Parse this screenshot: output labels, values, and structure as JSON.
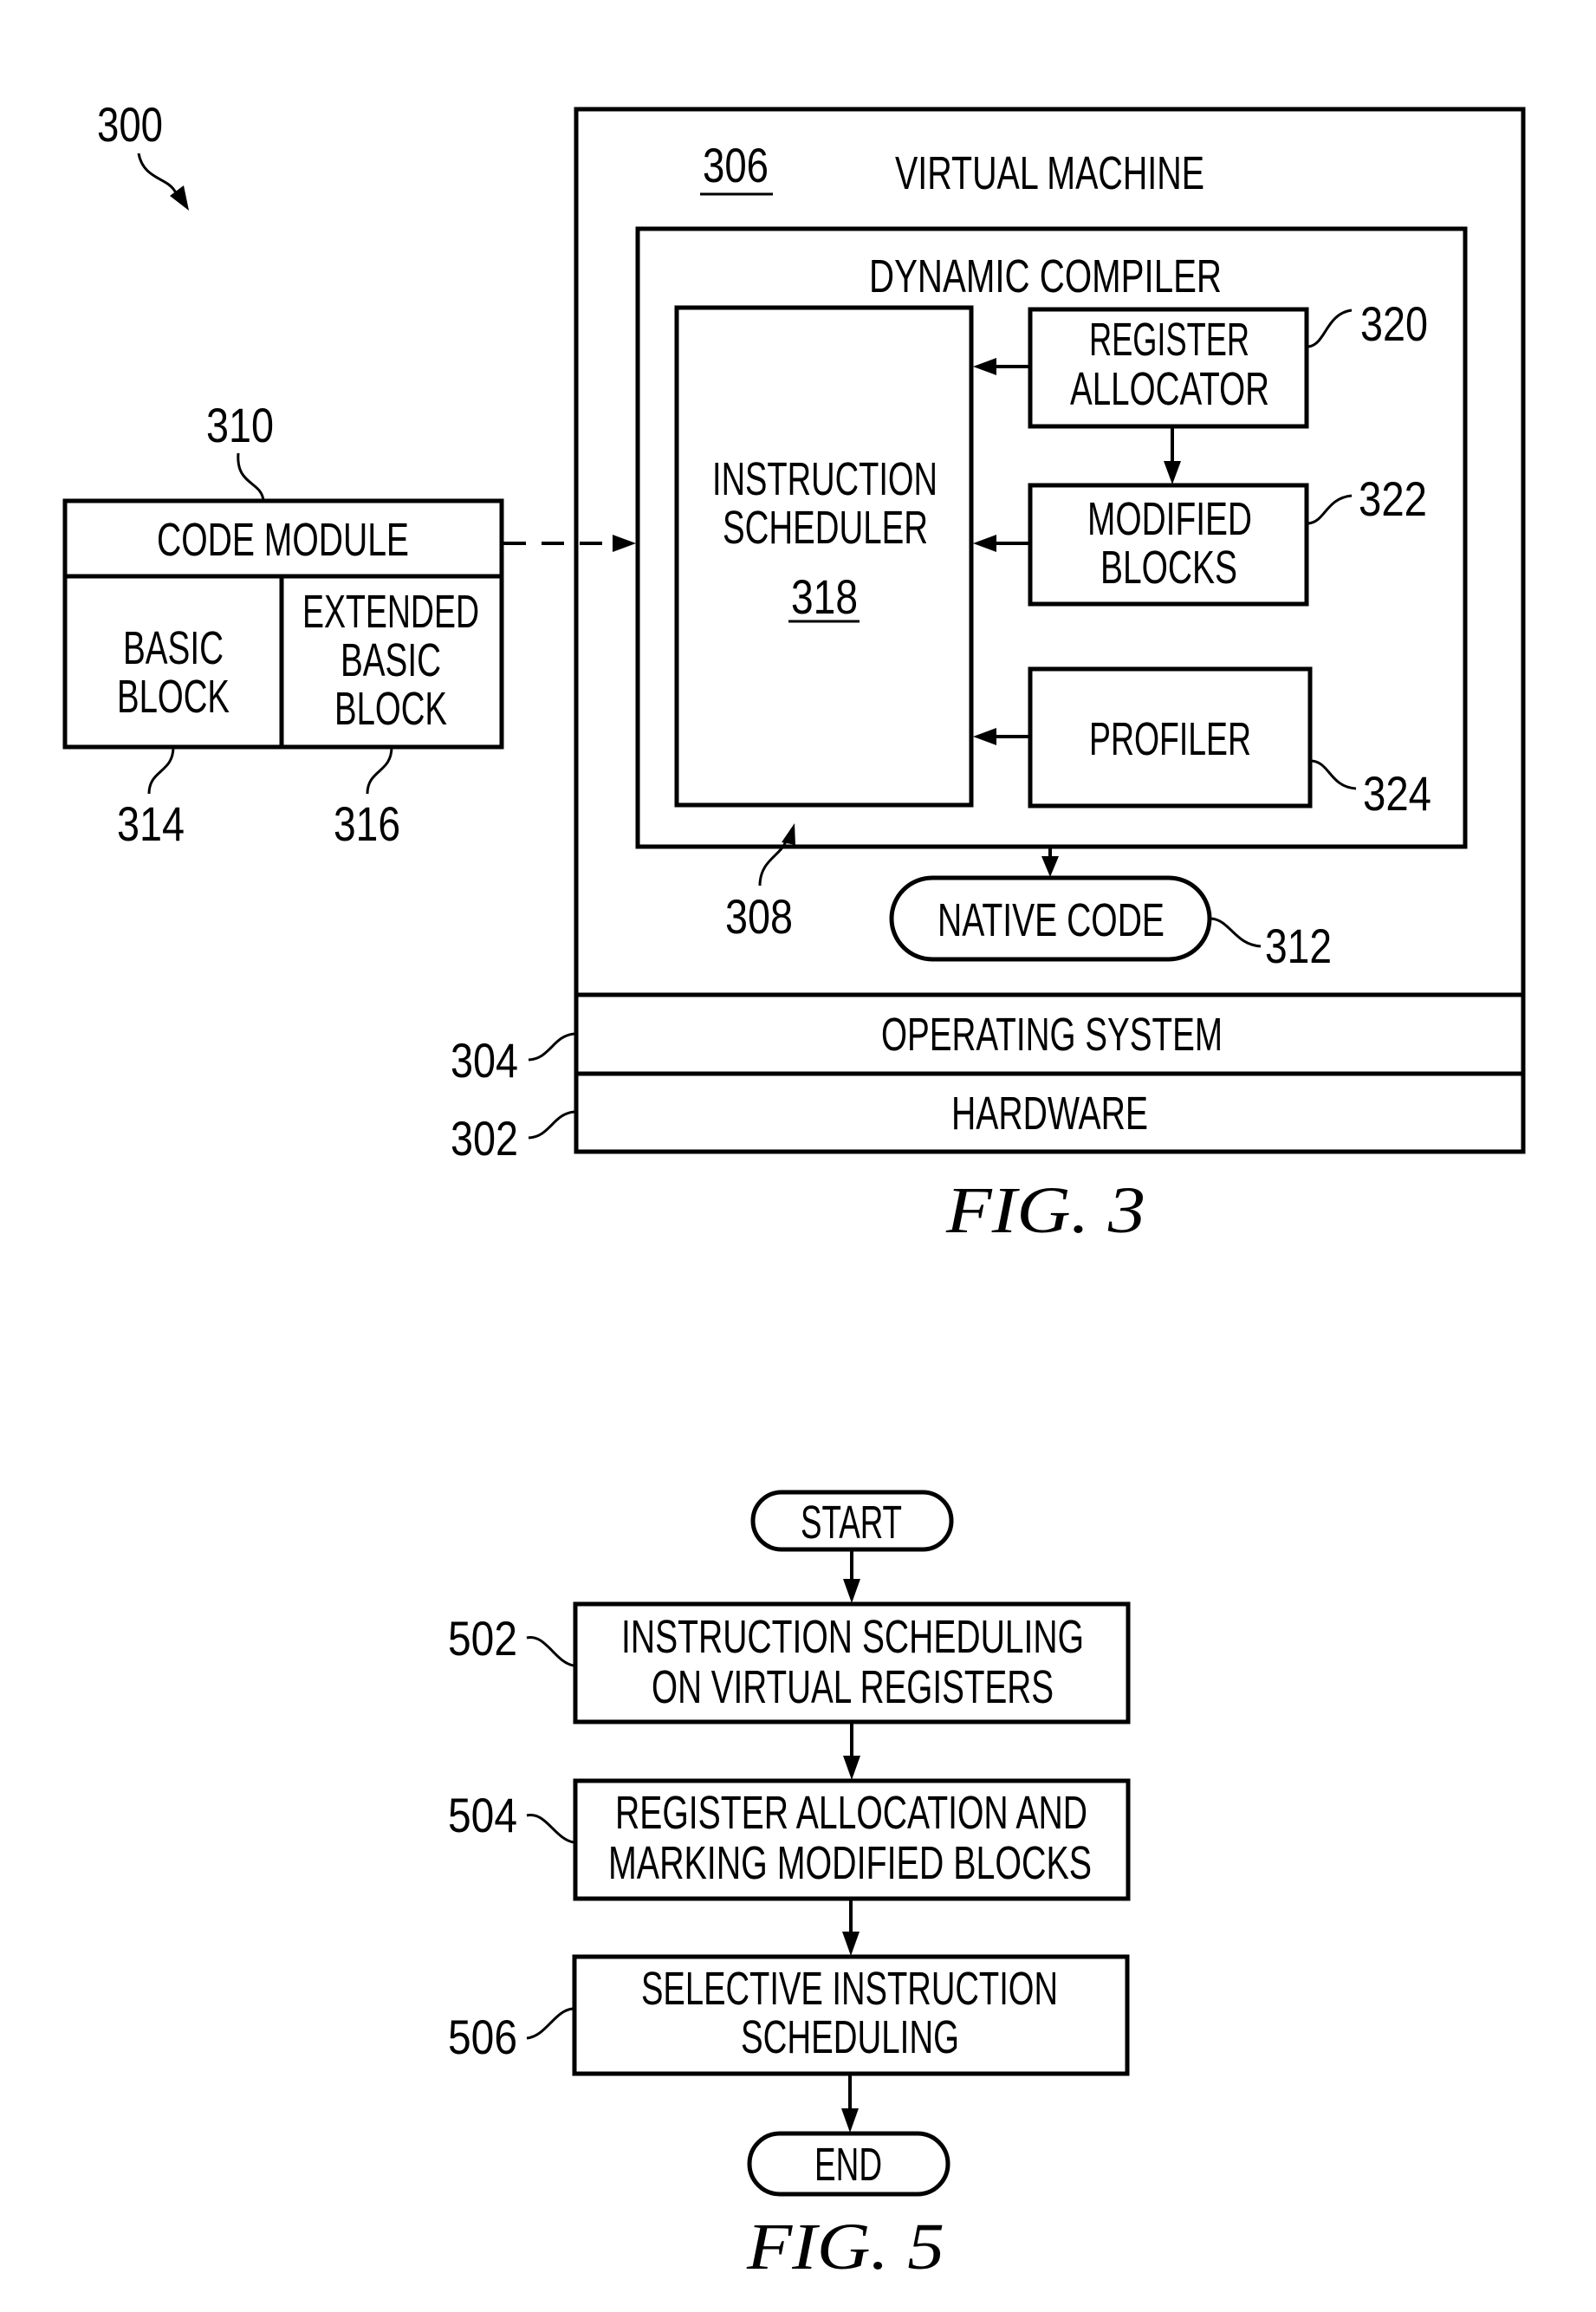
{
  "figures": {
    "fig3": {
      "caption": "FIG. 3",
      "ref_system": "300",
      "virtual_machine": {
        "ref": "306",
        "label": "VIRTUAL MACHINE"
      },
      "dynamic_compiler": {
        "ref": "308",
        "label": "DYNAMIC COMPILER"
      },
      "instruction_scheduler": {
        "ref": "318",
        "lines": [
          "INSTRUCTION",
          "SCHEDULER"
        ]
      },
      "register_allocator": {
        "ref": "320",
        "lines": [
          "REGISTER",
          "ALLOCATOR"
        ]
      },
      "modified_blocks": {
        "ref": "322",
        "lines": [
          "MODIFIED",
          "BLOCKS"
        ]
      },
      "profiler": {
        "ref": "324",
        "label": "PROFILER"
      },
      "native_code": {
        "ref": "312",
        "label": "NATIVE CODE"
      },
      "operating_system": {
        "ref": "304",
        "label": "OPERATING SYSTEM"
      },
      "hardware": {
        "ref": "302",
        "label": "HARDWARE"
      },
      "code_module": {
        "ref": "310",
        "label": "CODE MODULE",
        "basic_block": {
          "ref": "314",
          "lines": [
            "BASIC",
            "BLOCK"
          ]
        },
        "extended_basic_block": {
          "ref": "316",
          "lines": [
            "EXTENDED",
            "BASIC",
            "BLOCK"
          ]
        }
      }
    },
    "fig5": {
      "caption": "FIG. 5",
      "start": "START",
      "end": "END",
      "steps": [
        {
          "ref": "502",
          "lines": [
            "INSTRUCTION SCHEDULING",
            "ON VIRTUAL REGISTERS"
          ]
        },
        {
          "ref": "504",
          "lines": [
            "REGISTER ALLOCATION AND",
            "MARKING MODIFIED BLOCKS"
          ]
        },
        {
          "ref": "506",
          "lines": [
            "SELECTIVE INSTRUCTION",
            "SCHEDULING"
          ]
        }
      ]
    }
  }
}
